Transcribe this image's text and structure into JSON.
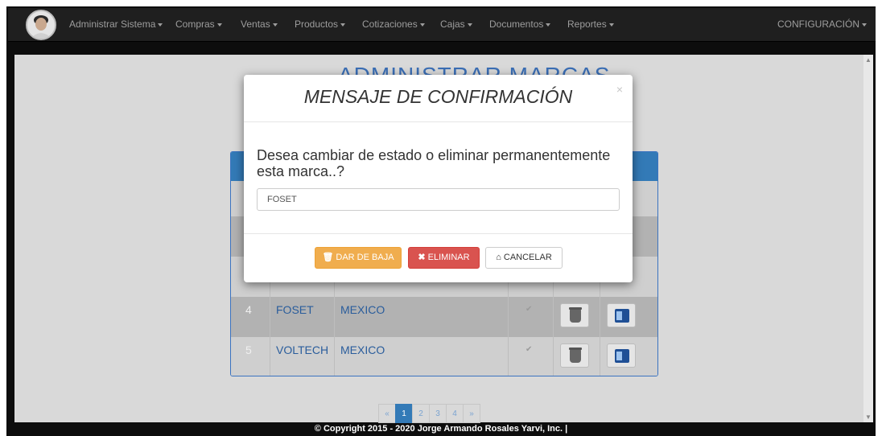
{
  "navbar": {
    "menu": [
      {
        "label": "Administrar Sistema",
        "key": "admin"
      },
      {
        "label": "Compras",
        "key": "compras"
      },
      {
        "label": "Ventas",
        "key": "ventas"
      },
      {
        "label": "Productos",
        "key": "productos"
      },
      {
        "label": "Cotizaciones",
        "key": "cotizaciones"
      },
      {
        "label": "Cajas",
        "key": "cajas"
      },
      {
        "label": "Documentos",
        "key": "documentos"
      },
      {
        "label": "Reportes",
        "key": "reportes"
      }
    ],
    "config_label": "CONFIGURACIÓN"
  },
  "page": {
    "title": "ADMINISTRAR MARCAS"
  },
  "table": {
    "rows": [
      {
        "num": "4",
        "marca": "FOSET",
        "pais": "MEXICO"
      },
      {
        "num": "5",
        "marca": "VOLTECH",
        "pais": "MEXICO"
      }
    ]
  },
  "pagination": {
    "prev": "«",
    "pages": [
      "1",
      "2",
      "3",
      "4"
    ],
    "next": "»",
    "active": "1"
  },
  "footer": {
    "text": "© Copyright 2015 - 2020 Jorge Armando Rosales Yarvi, Inc. |"
  },
  "modal": {
    "title": "MENSAJE DE CONFIRMACIÓN",
    "close": "×",
    "question": "Desea cambiar de estado o eliminar permanentemente esta marca..?",
    "input_value": "FOSET",
    "buttons": {
      "baja": "DAR DE BAJA",
      "eliminar": "ELIMINAR",
      "cancelar": "CANCELAR"
    }
  },
  "icons": {
    "baja_icon": "trash-icon",
    "eliminar_icon": "x-icon",
    "cancelar_icon": "home-icon"
  },
  "colors": {
    "navbar_bg": "#1f1f1f",
    "primary": "#337ab7",
    "warning": "#f0ad4e",
    "danger": "#d9534f"
  }
}
